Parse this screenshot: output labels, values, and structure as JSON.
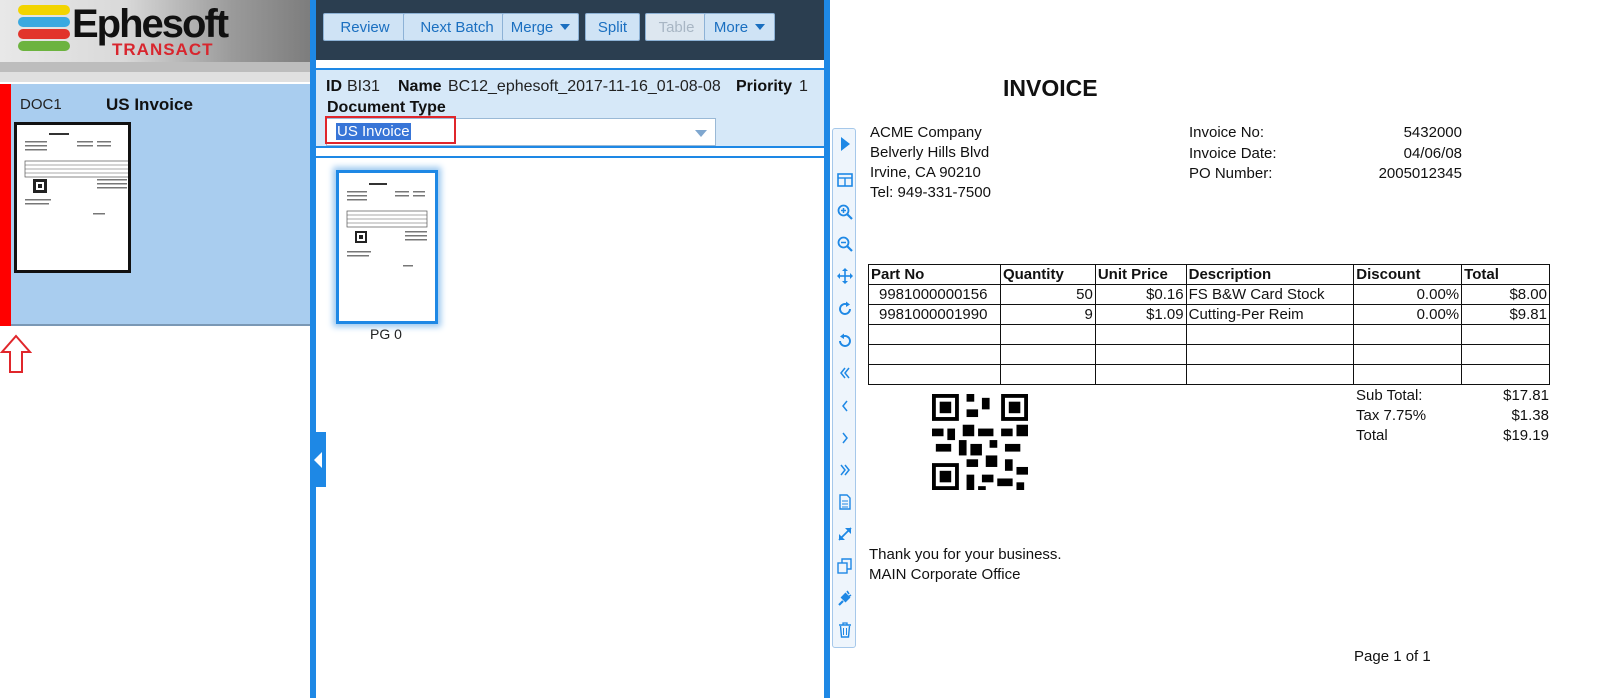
{
  "brand": {
    "name": "Ephesoft",
    "product": "TRANSACT"
  },
  "document": {
    "id": "DOC1",
    "type": "US Invoice"
  },
  "toolbar": {
    "review": "Review",
    "next_batch": "Next Batch",
    "merge": "Merge",
    "split": "Split",
    "table": "Table",
    "more": "More"
  },
  "batch": {
    "id_label": "ID",
    "id_value": "BI31",
    "name_label": "Name",
    "name_value": "BC12_ephesoft_2017-11-16_01-08-08",
    "priority_label": "Priority",
    "priority_value": "1",
    "doctype_label": "Document Type",
    "doctype_value": "US Invoice"
  },
  "page": {
    "label": "PG 0"
  },
  "colors": {
    "accent": "#1e88e5",
    "toolbar": "#2b3e50",
    "card": "#a9cdef",
    "error": "#ff0000"
  },
  "viewer_tools": [
    "play-icon",
    "split-view-icon",
    "zoom-in-icon",
    "zoom-out-icon",
    "move-icon",
    "rotate-cw-icon",
    "rotate-ccw-icon",
    "first-page-icon",
    "prev-page-icon",
    "next-page-icon",
    "last-page-icon",
    "document-icon",
    "fit-icon",
    "copy-icon",
    "plugin-icon",
    "delete-icon"
  ],
  "invoice": {
    "title": "INVOICE",
    "company": [
      "ACME Company",
      "Belverly Hills Blvd",
      "Irvine, CA 90210",
      "Tel: 949-331-7500"
    ],
    "meta": [
      {
        "label": "Invoice No:",
        "value": "5432000"
      },
      {
        "label": "Invoice Date:",
        "value": "04/06/08"
      },
      {
        "label": "PO Number:",
        "value": "2005012345"
      }
    ],
    "columns": [
      "Part No",
      "Quantity",
      "Unit Price",
      "Description",
      "Discount",
      "Total"
    ],
    "rows": [
      {
        "part": "9981000000156",
        "qty": "50",
        "price": "$0.16",
        "desc": "FS B&W Card Stock",
        "disc": "0.00%",
        "total": "$8.00"
      },
      {
        "part": "9981000001990",
        "qty": "9",
        "price": "$1.09",
        "desc": "Cutting-Per Reim",
        "disc": "0.00%",
        "total": "$9.81"
      }
    ],
    "totals": [
      {
        "label": "Sub Total:",
        "value": "$17.81"
      },
      {
        "label": "Tax 7.75%",
        "value": "$1.38"
      },
      {
        "label": "Total",
        "value": "$19.19"
      }
    ],
    "footer": [
      "Thank you for your business.",
      "MAIN Corporate Office"
    ],
    "page_info": "Page 1 of 1"
  }
}
